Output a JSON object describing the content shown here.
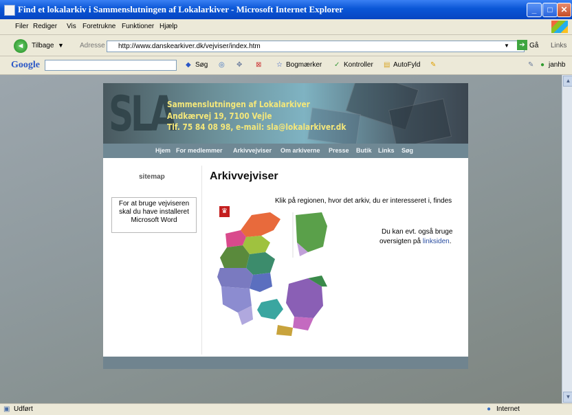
{
  "window": {
    "title": "Find et lokalarkiv i Sammenslutningen af Lokalarkiver - Microsoft Internet Explorer"
  },
  "menu": [
    "Filer",
    "Rediger",
    "Vis",
    "Foretrukne",
    "Funktioner",
    "Hjælp"
  ],
  "toolbar": {
    "back_label": "Tilbage",
    "address_label": "Adresse",
    "address_value": "http://www.danskearkiver.dk/vejviser/index.htm",
    "go_label": "Gå",
    "links_label": "Links"
  },
  "google_toolbar": {
    "brand": "Google",
    "search_label": "Søg",
    "bookmarks_label": "Bogmærker",
    "check_label": "Kontroller",
    "autofill_label": "AutoFyld",
    "user_label": "janhb"
  },
  "site": {
    "logo": "SLA",
    "org_name": "Sammenslutningen af Lokalarkiver",
    "address": "Andkærvej 19, 7100 Vejle",
    "contact": "Tlf. 75 84 08 98, e-mail: sla@lokalarkiver.dk",
    "nav": [
      "Hjem",
      "For medlemmer",
      "Arkivvejviser",
      "Om arkiverne",
      "Presse",
      "Butik",
      "Links",
      "Søg"
    ],
    "sitemap_label": "sitemap",
    "info_box": "For at bruge vejviseren skal du have installeret Microsoft Word",
    "heading": "Arkivvejviser",
    "instruction": "Klik på regionen, hvor det arkiv, du er interesseret i, findes",
    "alt_text_1": "Du kan evt. også bruge",
    "alt_text_2_prefix": "oversigten på ",
    "alt_link": "linksiden",
    "alt_text_2_suffix": "."
  },
  "status": {
    "left": "Udført",
    "zone": "Internet"
  },
  "colors": {
    "titlebar": "#0a56d6",
    "banner_text": "#f4e77a",
    "nav_bg": "#6f8894",
    "link": "#2a4ea1"
  }
}
